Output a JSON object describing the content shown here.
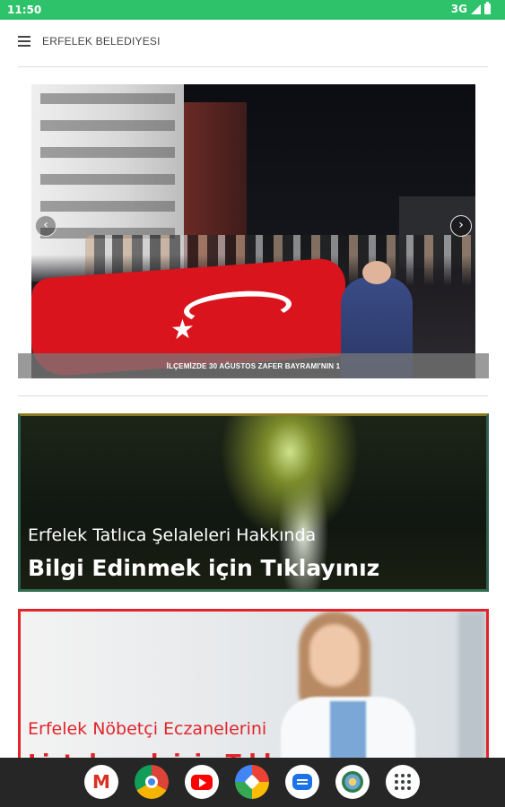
{
  "status_bar": {
    "time": "11:50",
    "network": "3G"
  },
  "app_bar": {
    "title": "ERFELEK BELEDIYESI"
  },
  "slider": {
    "caption": "İLÇEMİZDE 30 AĞUSTOS ZAFER BAYRAMI'NIN 1",
    "prev_icon": "chevron-left-icon",
    "next_icon": "chevron-right-icon",
    "prev_glyph": "‹",
    "next_glyph": "›"
  },
  "banners": {
    "falls": {
      "line1": "Erfelek Tatlıca Şelaleleri Hakkında",
      "line2": "Bilgi Edinmek için Tıklayınız",
      "border_color": "#2f6d4e"
    },
    "pharmacy": {
      "line1": "Erfelek Nöbetçi Eczanelerini",
      "line2": "Listelemek için Tıklayınız",
      "border_color": "#e0242a"
    }
  },
  "dock": {
    "apps": [
      "gmail-icon",
      "chrome-icon",
      "youtube-icon",
      "photos-icon",
      "messages-icon",
      "erfelek-app-icon",
      "app-drawer-icon"
    ],
    "gmail_glyph": "M"
  },
  "colors": {
    "status_bar": "#2ec26a",
    "nav_bar": "#262626"
  }
}
